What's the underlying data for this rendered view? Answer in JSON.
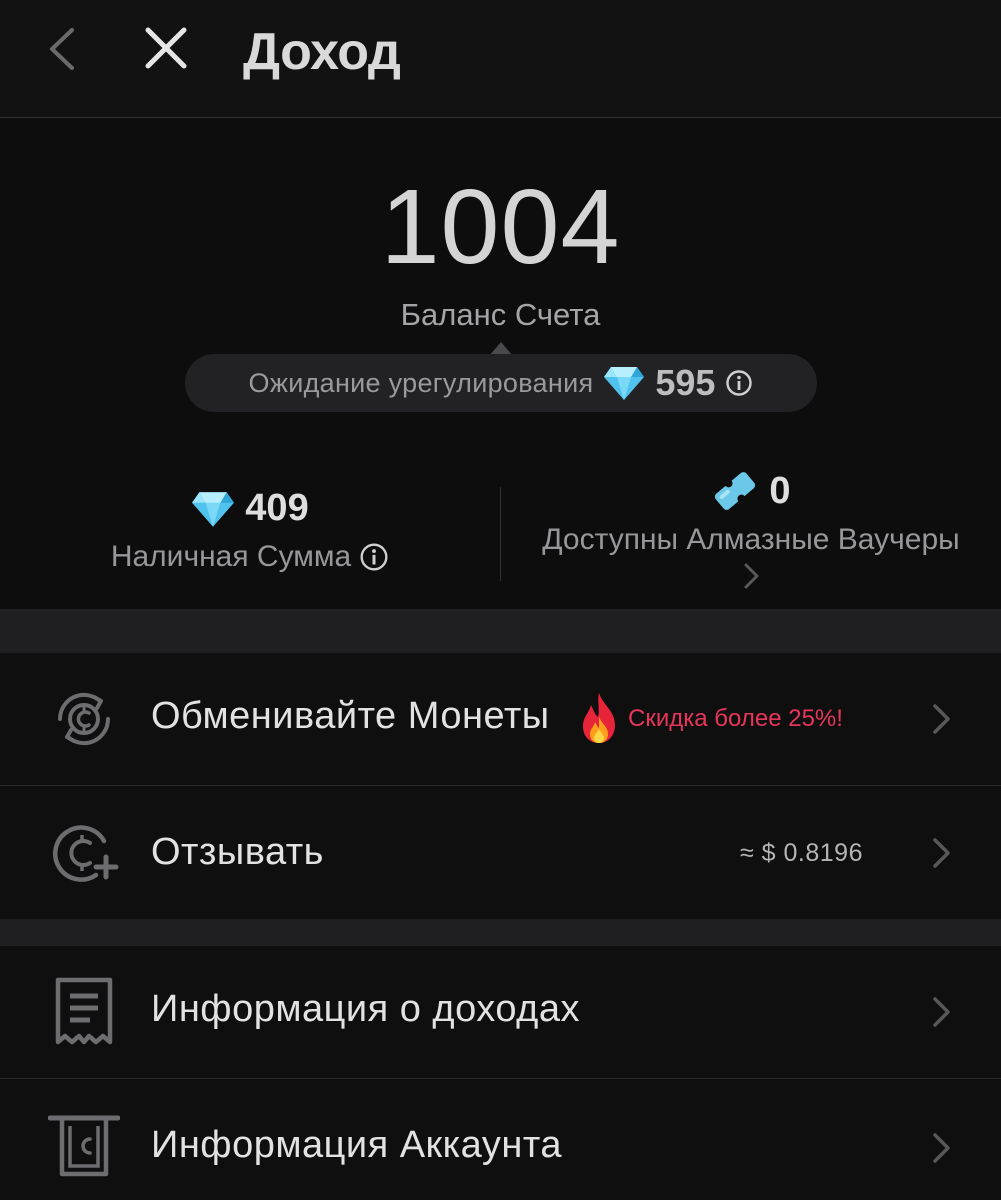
{
  "header": {
    "title": "Доход",
    "back_icon": "chevron-left-icon",
    "close_icon": "close-icon"
  },
  "balance": {
    "value": "1004",
    "label": "Баланс Счета"
  },
  "pending": {
    "label": "Ожидание урегулирования",
    "value": "595",
    "icon": "diamond-icon"
  },
  "stats": {
    "cash": {
      "value": "409",
      "label": "Наличная Сумма",
      "icon": "diamond-icon"
    },
    "vouchers": {
      "value": "0",
      "label": "Доступны Алмазные Ваучеры",
      "icon": "voucher-icon"
    }
  },
  "menu": {
    "exchange": {
      "label": "Обменивайте Монеты",
      "promo": "Скидка более 25%!",
      "icon": "coin-exchange-icon"
    },
    "withdraw": {
      "label": "Отзывать",
      "value": "≈ $ 0.8196",
      "icon": "coin-plus-icon"
    },
    "income_info": {
      "label": "Информация о доходах",
      "icon": "receipt-icon"
    },
    "account_info": {
      "label": "Информация Аккаунта",
      "icon": "account-card-icon"
    }
  },
  "colors": {
    "background": "#0d0d0e",
    "promo": "#e8355a",
    "diamond": "#5ad0f5",
    "voucher": "#6cc8e8"
  }
}
